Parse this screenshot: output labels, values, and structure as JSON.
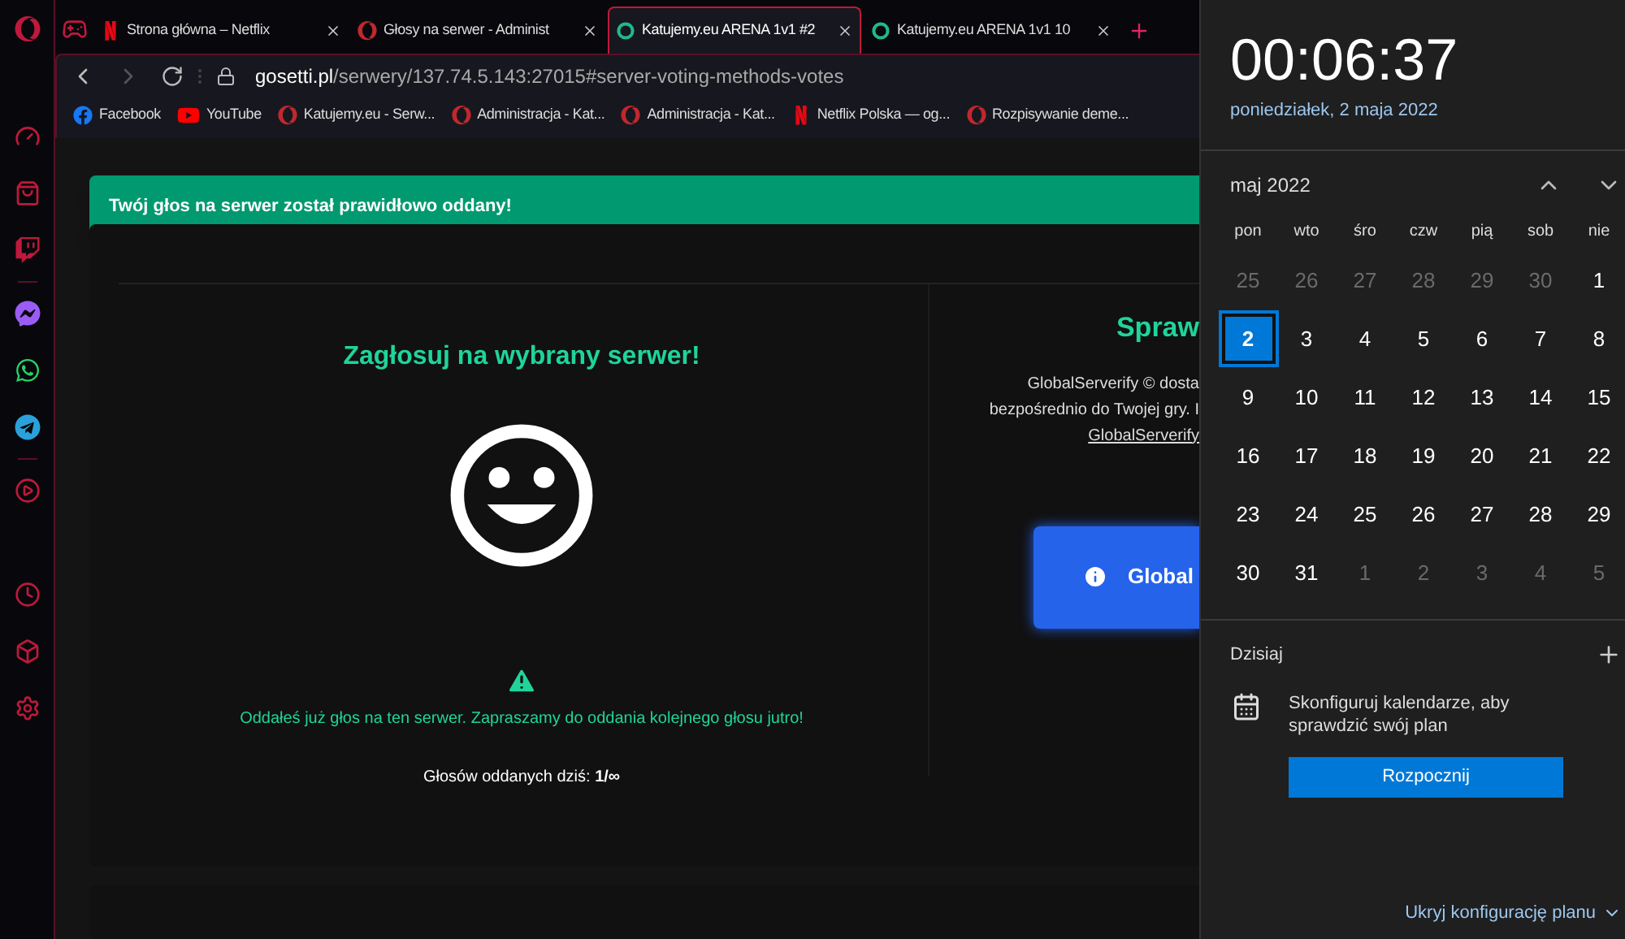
{
  "browser": {
    "tabs": [
      {
        "title": "Strona główna – Netflix",
        "kind": "netflix",
        "selected": false
      },
      {
        "title": "Głosy na serwer - Administ",
        "kind": "opera",
        "selected": false
      },
      {
        "title": "Katujemy.eu ARENA 1v1 #2",
        "kind": "ring",
        "selected": true
      },
      {
        "title": "Katujemy.eu ARENA 1v1 10",
        "kind": "ring",
        "selected": false
      }
    ],
    "address": {
      "host": "gosetti.pl",
      "path": "/serwery/137.74.5.143:27015#server-voting-methods-votes"
    },
    "bookmarks": [
      {
        "label": "Facebook",
        "kind": "facebook"
      },
      {
        "label": "YouTube",
        "kind": "youtube"
      },
      {
        "label": "Katujemy.eu - Serw...",
        "kind": "opera"
      },
      {
        "label": "Administracja - Kat...",
        "kind": "opera"
      },
      {
        "label": "Administracja - Kat...",
        "kind": "opera"
      },
      {
        "label": "Netflix Polska — og...",
        "kind": "netflix"
      },
      {
        "label": "Rozpisywanie deme...",
        "kind": "opera"
      }
    ],
    "notification": "Twój głos na serwer został prawidłowo oddany!",
    "vote_panel": {
      "title": "Zagłosuj na wybrany serwer!",
      "message": "Oddałeś już głos na ten serwer. Zapraszamy do oddania kolejnego głosu jutro!",
      "count": "Głosów oddanych dziś: **1/∞**"
    },
    "verify_panel": {
      "title": "Spraw",
      "lines": [
        "GlobalServerify © dosta",
        "bezpośrednio do Twojej gry. I"
      ],
      "link": "GlobalServerify",
      "button": "Global"
    }
  },
  "calendar": {
    "time": "00:06:37",
    "date": "poniedziałek, 2 maja 2022",
    "month": "maj 2022",
    "weekdays": [
      "pon",
      "wto",
      "śro",
      "czw",
      "pią",
      "sob",
      "nie"
    ],
    "weeks": [
      [
        {
          "day": "25",
          "outside": true,
          "selected": false
        },
        {
          "day": "26",
          "outside": true,
          "selected": false
        },
        {
          "day": "27",
          "outside": true,
          "selected": false
        },
        {
          "day": "28",
          "outside": true,
          "selected": false
        },
        {
          "day": "29",
          "outside": true,
          "selected": false
        },
        {
          "day": "30",
          "outside": true,
          "selected": false
        },
        {
          "day": "1",
          "outside": false,
          "selected": false
        }
      ],
      [
        {
          "day": "2",
          "outside": false,
          "selected": true
        },
        {
          "day": "3",
          "outside": false,
          "selected": false
        },
        {
          "day": "4",
          "outside": false,
          "selected": false
        },
        {
          "day": "5",
          "outside": false,
          "selected": false
        },
        {
          "day": "6",
          "outside": false,
          "selected": false
        },
        {
          "day": "7",
          "outside": false,
          "selected": false
        },
        {
          "day": "8",
          "outside": false,
          "selected": false
        }
      ],
      [
        {
          "day": "9",
          "outside": false,
          "selected": false
        },
        {
          "day": "10",
          "outside": false,
          "selected": false
        },
        {
          "day": "11",
          "outside": false,
          "selected": false
        },
        {
          "day": "12",
          "outside": false,
          "selected": false
        },
        {
          "day": "13",
          "outside": false,
          "selected": false
        },
        {
          "day": "14",
          "outside": false,
          "selected": false
        },
        {
          "day": "15",
          "outside": false,
          "selected": false
        }
      ],
      [
        {
          "day": "16",
          "outside": false,
          "selected": false
        },
        {
          "day": "17",
          "outside": false,
          "selected": false
        },
        {
          "day": "18",
          "outside": false,
          "selected": false
        },
        {
          "day": "19",
          "outside": false,
          "selected": false
        },
        {
          "day": "20",
          "outside": false,
          "selected": false
        },
        {
          "day": "21",
          "outside": false,
          "selected": false
        },
        {
          "day": "22",
          "outside": false,
          "selected": false
        }
      ],
      [
        {
          "day": "23",
          "outside": false,
          "selected": false
        },
        {
          "day": "24",
          "outside": false,
          "selected": false
        },
        {
          "day": "25",
          "outside": false,
          "selected": false
        },
        {
          "day": "26",
          "outside": false,
          "selected": false
        },
        {
          "day": "27",
          "outside": false,
          "selected": false
        },
        {
          "day": "28",
          "outside": false,
          "selected": false
        },
        {
          "day": "29",
          "outside": false,
          "selected": false
        }
      ],
      [
        {
          "day": "30",
          "outside": false,
          "selected": false
        },
        {
          "day": "31",
          "outside": false,
          "selected": false
        },
        {
          "day": "1",
          "outside": true,
          "selected": false
        },
        {
          "day": "2",
          "outside": true,
          "selected": false
        },
        {
          "day": "3",
          "outside": true,
          "selected": false
        },
        {
          "day": "4",
          "outside": true,
          "selected": false
        },
        {
          "day": "5",
          "outside": true,
          "selected": false
        }
      ]
    ],
    "today_label": "Dzisiaj",
    "agenda_text": "Skonfiguruj kalendarze, aby sprawdzić swój plan",
    "start_button": "Rozpocznij",
    "hide_link": "Ukryj konfigurację planu"
  }
}
